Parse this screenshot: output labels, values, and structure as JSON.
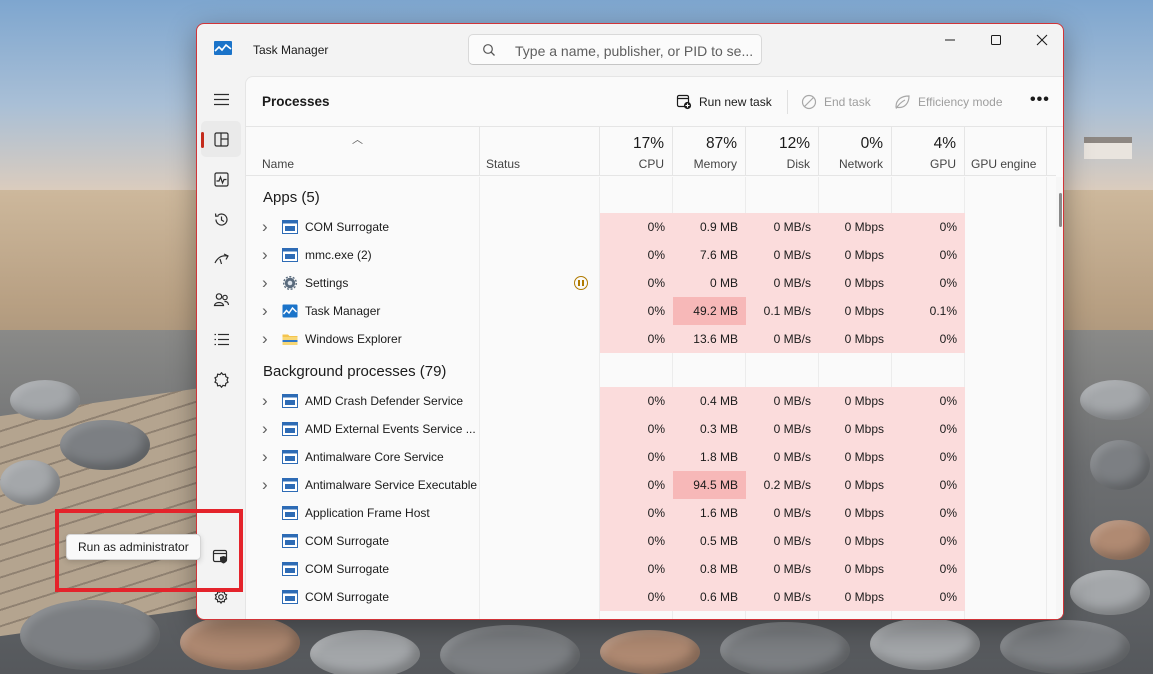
{
  "window": {
    "title": "Task Manager",
    "search_placeholder": "Type a name, publisher, or PID to se...",
    "controls": [
      "minimize",
      "maximize",
      "close"
    ]
  },
  "sidebar": {
    "items": [
      {
        "icon": "hamburger-menu-icon"
      },
      {
        "icon": "processes-icon",
        "active": true
      },
      {
        "icon": "performance-icon"
      },
      {
        "icon": "app-history-icon"
      },
      {
        "icon": "startup-apps-icon"
      },
      {
        "icon": "users-icon"
      },
      {
        "icon": "details-icon"
      },
      {
        "icon": "services-icon"
      }
    ],
    "bottom": {
      "icon": "run-as-administrator-icon",
      "tooltip": "Run as administrator"
    }
  },
  "commandbar": {
    "page_title": "Processes",
    "run_new_task": "Run new task",
    "end_task": "End task",
    "efficiency_mode": "Efficiency mode",
    "more": "•••"
  },
  "columns": {
    "name": {
      "label": "Name"
    },
    "status": {
      "label": "Status"
    },
    "cpu": {
      "pct": "17%",
      "label": "CPU"
    },
    "memory": {
      "pct": "87%",
      "label": "Memory"
    },
    "disk": {
      "pct": "12%",
      "label": "Disk"
    },
    "network": {
      "pct": "0%",
      "label": "Network"
    },
    "gpu": {
      "pct": "4%",
      "label": "GPU"
    },
    "gpu_engine": {
      "label": "GPU engine"
    }
  },
  "groups": [
    {
      "title": "Apps (5)",
      "rows": [
        {
          "name": "COM Surrogate",
          "icon": "app-window-icon",
          "expand": true,
          "status": "",
          "cpu": "0%",
          "memory": "0.9 MB",
          "disk": "0 MB/s",
          "network": "0 Mbps",
          "gpu": "0%"
        },
        {
          "name": "mmc.exe (2)",
          "icon": "app-window-icon",
          "expand": true,
          "status": "",
          "cpu": "0%",
          "memory": "7.6 MB",
          "disk": "0 MB/s",
          "network": "0 Mbps",
          "gpu": "0%"
        },
        {
          "name": "Settings",
          "icon": "settings-gear-icon",
          "expand": true,
          "status": "paused",
          "cpu": "0%",
          "memory": "0 MB",
          "disk": "0 MB/s",
          "network": "0 Mbps",
          "gpu": "0%"
        },
        {
          "name": "Task Manager",
          "icon": "task-manager-icon",
          "expand": true,
          "status": "",
          "cpu": "0%",
          "memory": "49.2 MB",
          "memory_hot": true,
          "disk": "0.1 MB/s",
          "network": "0 Mbps",
          "gpu": "0.1%"
        },
        {
          "name": "Windows Explorer",
          "icon": "folder-icon",
          "expand": true,
          "status": "",
          "cpu": "0%",
          "memory": "13.6 MB",
          "disk": "0 MB/s",
          "network": "0 Mbps",
          "gpu": "0%"
        }
      ]
    },
    {
      "title": "Background processes (79)",
      "rows": [
        {
          "name": "AMD Crash Defender Service",
          "icon": "app-window-icon",
          "expand": true,
          "status": "",
          "cpu": "0%",
          "memory": "0.4 MB",
          "disk": "0 MB/s",
          "network": "0 Mbps",
          "gpu": "0%"
        },
        {
          "name": "AMD External Events Service ...",
          "icon": "app-window-icon",
          "expand": true,
          "status": "",
          "cpu": "0%",
          "memory": "0.3 MB",
          "disk": "0 MB/s",
          "network": "0 Mbps",
          "gpu": "0%"
        },
        {
          "name": "Antimalware Core Service",
          "icon": "app-window-icon",
          "expand": true,
          "status": "",
          "cpu": "0%",
          "memory": "1.8 MB",
          "disk": "0 MB/s",
          "network": "0 Mbps",
          "gpu": "0%"
        },
        {
          "name": "Antimalware Service Executable",
          "icon": "app-window-icon",
          "expand": true,
          "status": "",
          "cpu": "0%",
          "memory": "94.5 MB",
          "memory_hot": true,
          "disk": "0.2 MB/s",
          "network": "0 Mbps",
          "gpu": "0%"
        },
        {
          "name": "Application Frame Host",
          "icon": "app-window-icon",
          "expand": false,
          "status": "",
          "cpu": "0%",
          "memory": "1.6 MB",
          "disk": "0 MB/s",
          "network": "0 Mbps",
          "gpu": "0%"
        },
        {
          "name": "COM Surrogate",
          "icon": "app-window-icon",
          "expand": false,
          "status": "",
          "cpu": "0%",
          "memory": "0.5 MB",
          "disk": "0 MB/s",
          "network": "0 Mbps",
          "gpu": "0%"
        },
        {
          "name": "COM Surrogate",
          "icon": "app-window-icon",
          "expand": false,
          "status": "",
          "cpu": "0%",
          "memory": "0.8 MB",
          "disk": "0 MB/s",
          "network": "0 Mbps",
          "gpu": "0%"
        },
        {
          "name": "COM Surrogate",
          "icon": "app-window-icon",
          "expand": false,
          "status": "",
          "cpu": "0%",
          "memory": "0.6 MB",
          "disk": "0 MB/s",
          "network": "0 Mbps",
          "gpu": "0%"
        }
      ]
    }
  ],
  "colors": {
    "accent": "#c42b1c",
    "heat_light": "#fbdcdc",
    "heat_strong": "#f7b8b8",
    "annotation": "#e4232b"
  }
}
